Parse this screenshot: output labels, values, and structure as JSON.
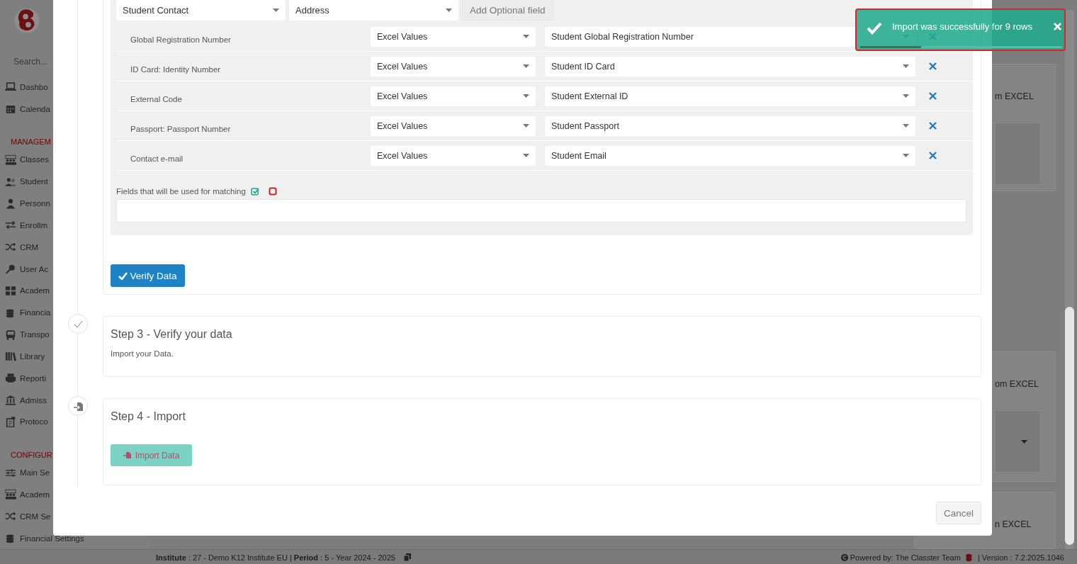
{
  "sidebar": {
    "search_placeholder": "Search...",
    "items": [
      {
        "kind": "link",
        "label": "Dashbo"
      },
      {
        "kind": "link",
        "label": "Calenda"
      },
      {
        "kind": "heading",
        "label": "MANAGEM"
      },
      {
        "kind": "link",
        "label": "Classes"
      },
      {
        "kind": "link",
        "label": "Student"
      },
      {
        "kind": "link",
        "label": "Personn"
      },
      {
        "kind": "link",
        "label": "Enrollm"
      },
      {
        "kind": "link",
        "label": "CRM"
      },
      {
        "kind": "link",
        "label": "User Ac"
      },
      {
        "kind": "link",
        "label": "Academ"
      },
      {
        "kind": "link",
        "label": "Financia"
      },
      {
        "kind": "link",
        "label": "Transpo"
      },
      {
        "kind": "link",
        "label": "Library"
      },
      {
        "kind": "link",
        "label": "Reporti"
      },
      {
        "kind": "link",
        "label": "Admiss"
      },
      {
        "kind": "link",
        "label": "Protoco"
      },
      {
        "kind": "heading",
        "label": "CONFIGUR"
      },
      {
        "kind": "link",
        "label": "Main Se"
      },
      {
        "kind": "link",
        "label": "Academ"
      },
      {
        "kind": "link",
        "label": "CRM Se"
      },
      {
        "kind": "link",
        "label": "Financial Settings"
      }
    ]
  },
  "background_cards": [
    {
      "kind": "box",
      "text": "m EXCEL"
    },
    {
      "kind": "select",
      "text": "om EXCEL"
    },
    {
      "kind": "plain",
      "text": "n EXCEL"
    }
  ],
  "modal": {
    "optional_fields": [
      "Student Contact",
      "Address"
    ],
    "add_field_button": "Add Optional field",
    "mappings": [
      {
        "field": "Global Registration Number",
        "source": "Excel Values",
        "target": "Student Global Registration Number"
      },
      {
        "field": "ID Card: Identity Number",
        "source": "Excel Values",
        "target": "Student ID Card"
      },
      {
        "field": "External Code",
        "source": "Excel Values",
        "target": "Student External ID"
      },
      {
        "field": "Passport: Passport Number",
        "source": "Excel Values",
        "target": "Student Passport"
      },
      {
        "field": "Contact e-mail",
        "source": "Excel Values",
        "target": "Student Email"
      }
    ],
    "matching_label": "Fields that will be used for matching",
    "verify_button": "Verify Data",
    "steps": [
      {
        "kind": "done",
        "title": "Step 3 - Verify your data",
        "description": "Import your Data."
      },
      {
        "kind": "import",
        "title": "Step 4 - Import",
        "button": "Import Data"
      }
    ],
    "cancel_button": "Cancel"
  },
  "toast": {
    "message": "Import was successfully for 9 rows",
    "progress": {
      "level": 0.3
    }
  },
  "footer": {
    "context": "**Institute** : 27 - Demo K12 Institute EU | **Period** : 5 - Year 2024 - 2025",
    "credit": "Powered by: The Classter Team",
    "version": "| Version : 7.2.2025.1046"
  }
}
